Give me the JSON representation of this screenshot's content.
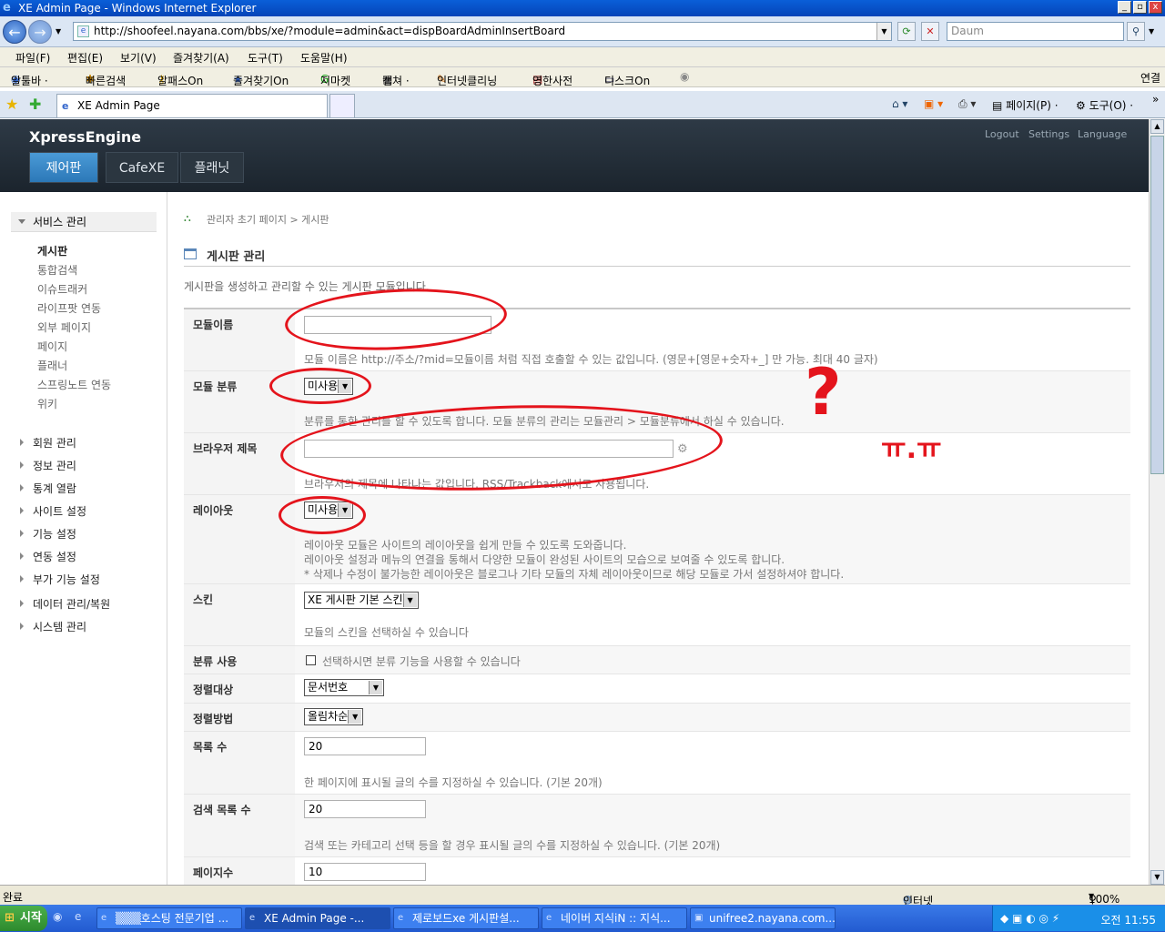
{
  "window": {
    "title": "XE Admin Page - Windows Internet Explorer"
  },
  "browser": {
    "url": "http://shoofeel.nayana.com/bbs/xe/?module=admin&act=dispBoardAdminInsertBoard",
    "search_placeholder": "Daum",
    "menu": [
      "파일(F)",
      "편집(E)",
      "보기(V)",
      "즐겨찾기(A)",
      "도구(T)",
      "도움말(H)"
    ],
    "toolbar": [
      "알툴바 ·",
      "빠른검색",
      "알패스On",
      "즐겨찾기On",
      "지마켓",
      "캡쳐 ·",
      "인터넷클리닝",
      "영한사전",
      "디스크On"
    ],
    "toolbar_right": "연결",
    "tab_title": "XE Admin Page",
    "tab_right": [
      "페이지(P) ·",
      "도구(O) ·"
    ]
  },
  "xe": {
    "logo": "XpressEngine",
    "nav": [
      "제어판",
      "CafeXE",
      "플래닛"
    ],
    "toplinks": [
      "Logout",
      "Settings",
      "Language"
    ]
  },
  "sidebar": {
    "head": "서비스 관리",
    "sub": [
      "게시판",
      "통합검색",
      "이슈트래커",
      "라이프팟 연동",
      "외부 페이지",
      "페이지",
      "플래너",
      "스프링노트 연동",
      "위키"
    ],
    "main": [
      "회원 관리",
      "정보 관리",
      "통계 열람",
      "사이트 설정",
      "기능 설정",
      "연동 설정",
      "부가 기능 설정",
      "데이터 관리/복원",
      "시스템 관리"
    ]
  },
  "content": {
    "breadcrumb": "관리자 초기 페이지 > 게시판",
    "title": "게시판 관리",
    "desc": "게시판을 생성하고 관리할 수 있는 게시판 모듈입니다.",
    "rows": {
      "module_name": {
        "label": "모듈이름",
        "value": "",
        "help": "모듈 이름은 http://주소/?mid=모듈이름 처럼 직접 호출할 수 있는 값입니다. (영문+[영문+숫자+_] 만 가능. 최대 40 글자)"
      },
      "module_cat": {
        "label": "모듈 분류",
        "value": "미사용",
        "help": "분류를 통한 관리를 할 수 있도록 합니다. 모듈 분류의 관리는 모듈관리 > 모듈분류에서 하실 수 있습니다."
      },
      "browser_title": {
        "label": "브라우저 제목",
        "value": "",
        "help": "브라우저의 제목에 나타나는 값입니다. RSS/Trackback에서도 사용됩니다."
      },
      "layout": {
        "label": "레이아웃",
        "value": "미사용",
        "help1": "레이아웃 모듈은 사이트의 레이아웃을 쉽게 만들 수 있도록 도와줍니다.",
        "help2": "레이아웃 설정과 메뉴의 연결을 통해서 다양한 모듈이 완성된 사이트의 모습으로 보여줄 수 있도록 합니다.",
        "help3": "* 삭제나 수정이 불가능한 레이아웃은 블로그나 기타 모듈의 자체 레이아웃이므로 해당 모듈로 가서 설정하셔야 합니다."
      },
      "skin": {
        "label": "스킨",
        "value": "XE 게시판 기본 스킨",
        "help": "모듈의 스킨을 선택하실 수 있습니다"
      },
      "use_category": {
        "label": "분류 사용",
        "help": "선택하시면 분류 기능을 사용할 수 있습니다"
      },
      "sort_target": {
        "label": "정렬대상",
        "value": "문서번호"
      },
      "sort_order": {
        "label": "정렬방법",
        "value": "올림차순"
      },
      "list_count": {
        "label": "목록 수",
        "value": "20",
        "help": "한 페이지에 표시될 글의 수를 지정하실 수 있습니다. (기본 20개)"
      },
      "search_list_count": {
        "label": "검색 목록 수",
        "value": "20",
        "help": "검색 또는 카테고리 선택 등을 할 경우 표시될 글의 수를 지정하실 수 있습니다. (기본 20개)"
      },
      "page_count": {
        "label": "페이지수",
        "value": "10"
      }
    }
  },
  "annotation": {
    "text": "ㅠ.ㅠ",
    "question": "?"
  },
  "status": {
    "left": "완료",
    "zone": "인터넷",
    "zoom": "100%"
  },
  "taskbar": {
    "start": "시작",
    "items": [
      "▒▒▒호스팅 전문기업 ...",
      "XE Admin Page -...",
      "제로보드xe 게시판설...",
      "네이버 지식iN :: 지식...",
      "unifree2.nayana.com..."
    ],
    "clock": "오전 11:55"
  }
}
